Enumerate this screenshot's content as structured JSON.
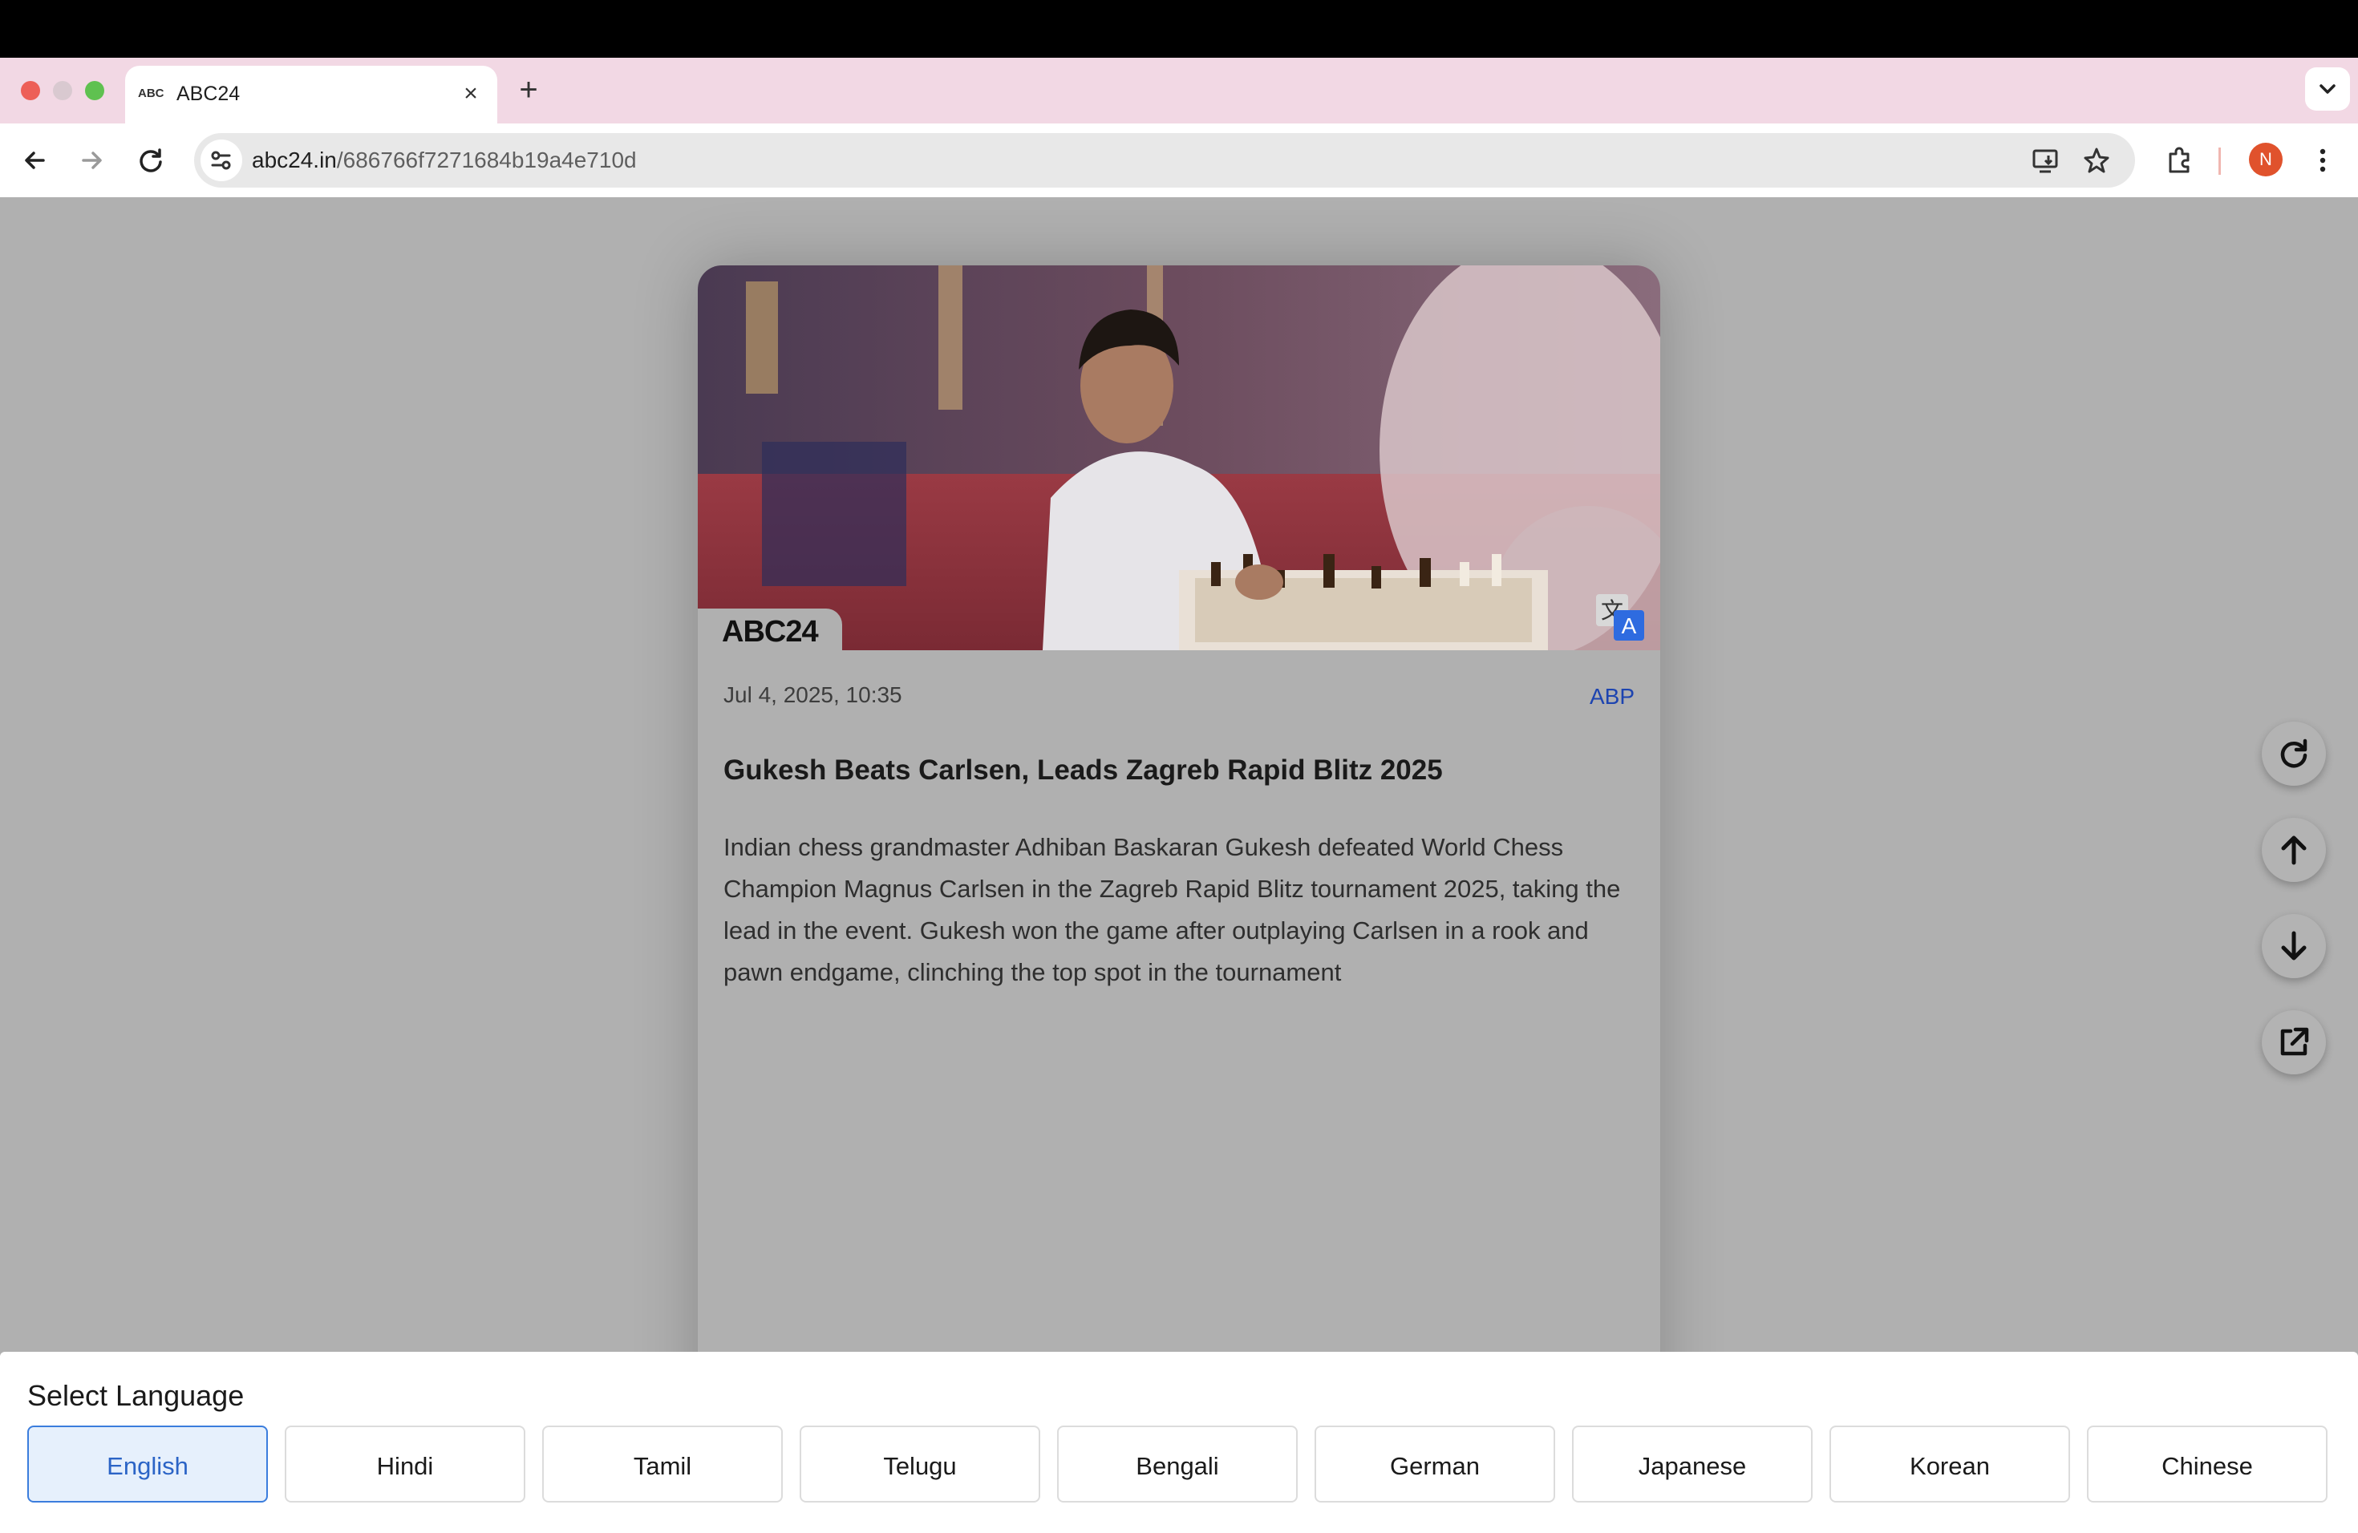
{
  "browser": {
    "tab_title": "ABC24",
    "tab_favicon_text": "ABC",
    "url_host": "abc24.in",
    "url_path": "/686766f7271684b19a4e710d",
    "profile_initial": "N"
  },
  "article": {
    "brand_logo": "ABC24",
    "date": "Jul 4, 2025, 10:35",
    "source": "ABP",
    "headline": "Gukesh Beats Carlsen, Leads Zagreb Rapid Blitz 2025",
    "body": "Indian chess grandmaster Adhiban Baskaran Gukesh defeated World Chess Champion Magnus Carlsen in the Zagreb Rapid Blitz tournament 2025, taking the lead in the event. Gukesh won the game after outplaying Carlsen in a rook and pawn endgame, clinching the top spot in the tournament",
    "translate_glyph": "文",
    "translate_letter": "A"
  },
  "side_actions": [
    "refresh-icon",
    "arrow-up-icon",
    "arrow-down-icon",
    "external-link-icon"
  ],
  "language_panel": {
    "title": "Select Language",
    "selected": "English",
    "languages": [
      "English",
      "Hindi",
      "Tamil",
      "Telugu",
      "Bengali",
      "German",
      "Japanese",
      "Korean",
      "Chinese"
    ]
  },
  "colors": {
    "accent": "#2b64c6",
    "source_link": "#1d44b0",
    "profile_avatar": "#e0522c",
    "tabstrip": "#f2d8e4",
    "overlay": "#b0b0b0"
  }
}
